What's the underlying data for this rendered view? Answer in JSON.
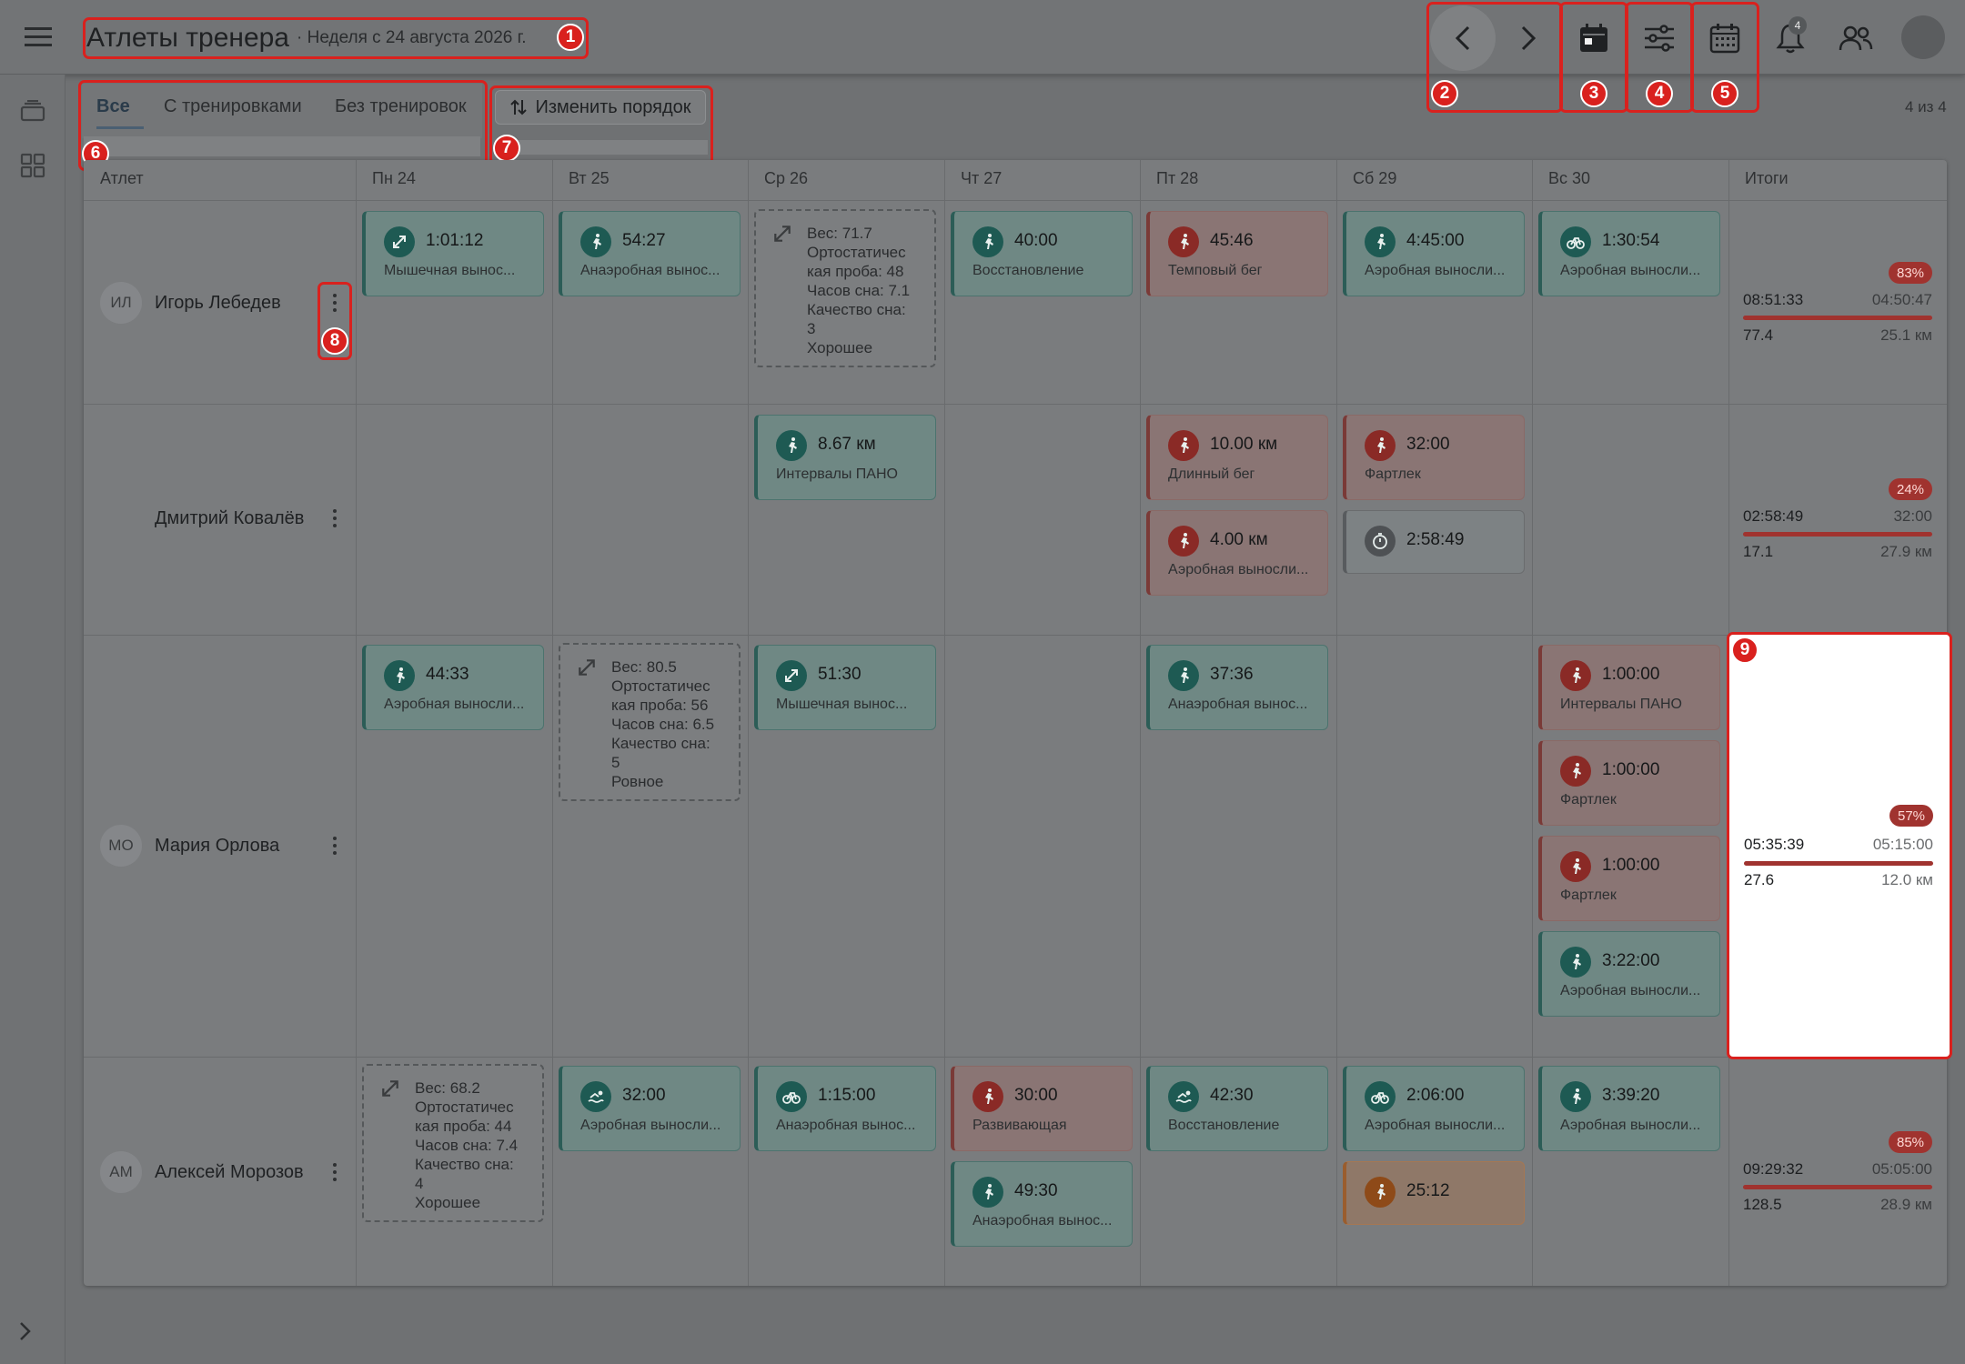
{
  "header": {
    "title": "Атлеты тренера",
    "subtitle": "· Неделя с 24 августа 2026 г.",
    "notifications_count": "4"
  },
  "markers": [
    "1",
    "2",
    "3",
    "4",
    "5",
    "6",
    "7",
    "8",
    "9"
  ],
  "tabs": [
    {
      "label": "Все",
      "active": true
    },
    {
      "label": "С тренировками",
      "active": false
    },
    {
      "label": "Без тренировок",
      "active": false
    }
  ],
  "reorder_label": "Изменить порядок",
  "counter": "4 из 4",
  "columns": [
    "Атлет",
    "Пн 24",
    "Вт 25",
    "Ср 26",
    "Чт 27",
    "Пт 28",
    "Сб 29",
    "Вс 30",
    "Итоги"
  ],
  "athletes": [
    {
      "initials": "ИЛ",
      "name": "Игорь Лебедев",
      "cards": [
        {
          "value": "1:01:12",
          "label": "Мышечная вынос..."
        },
        {
          "value": "54:27",
          "label": "Анаэробная вынос..."
        },
        {
          "note": [
            "Вес: 71.7",
            "Ортостатичес",
            "кая проба: 48",
            "Часов сна: 7.1",
            "Качество сна:",
            "3",
            "Хорошее"
          ]
        },
        {
          "value": "40:00",
          "label": "Восстановление"
        },
        {
          "value": "45:46",
          "label": "Темповый бег"
        },
        {
          "value": "4:45:00",
          "label": "Аэробная выносли..."
        },
        {
          "value": "1:30:54",
          "label": "Аэробная выносли..."
        }
      ],
      "totals": {
        "pct": "83%",
        "time": "08:51:33",
        "time_plan": "04:50:47",
        "load": "77.4",
        "dist": "25.1 км"
      }
    },
    {
      "initials": "",
      "name": "Дмитрий Ковалёв",
      "cards": [
        {
          "value": "8.67 км",
          "label": "Интервалы ПАНО"
        },
        {
          "value": "10.00 км",
          "label": "Длинный бег"
        },
        {
          "value": "4.00 км",
          "label": "Аэробная выносли..."
        },
        {
          "value": "32:00",
          "label": "Фартлек"
        },
        {
          "value": "2:58:49",
          "label": ""
        }
      ],
      "totals": {
        "pct": "24%",
        "time": "02:58:49",
        "time_plan": "32:00",
        "load": "17.1",
        "dist": "27.9 км"
      }
    },
    {
      "initials": "МО",
      "name": "Мария Орлова",
      "cards": [
        {
          "value": "44:33",
          "label": "Аэробная выносли..."
        },
        {
          "note": [
            "Вес: 80.5",
            "Ортостатичес",
            "кая проба: 56",
            "Часов сна: 6.5",
            "Качество сна:",
            "5",
            "Ровное"
          ]
        },
        {
          "value": "51:30",
          "label": "Мышечная вынос..."
        },
        {
          "value": "37:36",
          "label": "Анаэробная вынос..."
        },
        {
          "value": "1:00:00",
          "label": "Интервалы ПАНО"
        },
        {
          "value": "1:00:00",
          "label": "Фартлек"
        },
        {
          "value": "1:00:00",
          "label": "Фартлек"
        },
        {
          "value": "3:22:00",
          "label": "Аэробная выносли..."
        }
      ],
      "totals": {
        "pct": "57%",
        "time": "05:35:39",
        "time_plan": "05:15:00",
        "load": "27.6",
        "dist": "12.0 км"
      }
    },
    {
      "initials": "АМ",
      "name": "Алексей Морозов",
      "cards": [
        {
          "note": [
            "Вес: 68.2",
            "Ортостатичес",
            "кая проба: 44",
            "Часов сна: 7.4",
            "Качество сна:",
            "4",
            "Хорошее"
          ]
        },
        {
          "value": "32:00",
          "label": "Аэробная выносли..."
        },
        {
          "value": "1:15:00",
          "label": "Анаэробная вынос..."
        },
        {
          "value": "30:00",
          "label": "Развивающая"
        },
        {
          "value": "49:30",
          "label": "Анаэробная вынос..."
        },
        {
          "value": "42:30",
          "label": "Восстановление"
        },
        {
          "value": "2:06:00",
          "label": "Аэробная выносли..."
        },
        {
          "value": "25:12",
          "label": ""
        },
        {
          "value": "3:39:20",
          "label": "Аэробная выносли..."
        }
      ],
      "totals": {
        "pct": "85%",
        "time": "09:29:32",
        "time_plan": "05:05:00",
        "load": "128.5",
        "dist": "28.9 км"
      }
    }
  ],
  "colors": {
    "accent_red": "#d9211e",
    "workout_green": "#1e5a53",
    "workout_red": "#8a2a26",
    "workout_orange": "#8e4a18"
  }
}
